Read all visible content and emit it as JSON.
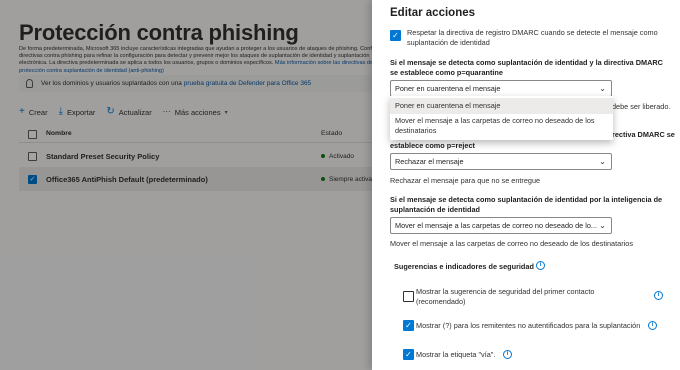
{
  "background": {
    "title": "Protección contra phishing",
    "description": "De forma predeterminada, Microsoft 365 incluye características integradas que ayudan a proteger a los usuarios de ataques de phishing. Configure directivas contra phishing para refinar la configuración para detectar y prevenir mejor los ataques de suplantación de identidad y suplantación electrónica. La directiva predeterminada se aplica a todos los usuarios, grupos o dominios específicos.",
    "description_link": "Más información sobre las directivas de protección contra suplantación de identidad (anti-phishing)",
    "info_text": "Ver los dominios y usuarios suplantados con una",
    "info_link": "prueba gratuita de Defender para Office 365",
    "toolbar": {
      "create": "Crear",
      "export": "Exportar",
      "refresh": "Actualizar",
      "more": "Más acciones"
    },
    "table": {
      "col_name": "Nombre",
      "col_state": "Estado",
      "rows": [
        {
          "name": "Standard Preset Security Policy",
          "state": "Activado"
        },
        {
          "name": "Office365 AntiPhish Default (predeterminado)",
          "state": "Siempre activado"
        }
      ]
    }
  },
  "panel": {
    "title": "Editar acciones",
    "dmarc_checkbox_label": "Respetar la directiva de registro DMARC cuando se detecte el mensaje como suplantación de identidad",
    "quarantine_heading": "Si el mensaje se detecta como suplantación de identidad y la directiva DMARC se establece como p=quarantine",
    "quarantine_selected": "Poner en cuarentena el mensaje",
    "quarantine_options": [
      "Poner en cuarentena el mensaje",
      "Mover el mensaje a las carpetas de correo no deseado de los destinatarios"
    ],
    "hidden_text_fragment": "debe ser liberado.",
    "reject_heading_fragment": "rectiva DMARC se",
    "reject_heading_tail": "establece como p=reject",
    "reject_selected": "Rechazar el mensaje",
    "reject_description": "Rechazar el mensaje para que no se entregue",
    "intel_heading": "Si el mensaje se detecta como suplantación de identidad por la inteligencia de suplantación de identidad",
    "intel_selected": "Mover el mensaje a las carpetas de correo no deseado de lo...",
    "intel_description": "Mover el mensaje a las carpetas de correo no deseado de los destinatarios",
    "tips_heading": "Sugerencias e indicadores de seguridad",
    "tips": [
      {
        "label": "Mostrar la sugerencia de seguridad del primer contacto (recomendado)",
        "checked": false
      },
      {
        "label": "Mostrar (?) para los remitentes no autentificados para la suplantación",
        "checked": true
      },
      {
        "label": "Mostrar la etiqueta \"vía\".",
        "checked": true
      }
    ]
  }
}
